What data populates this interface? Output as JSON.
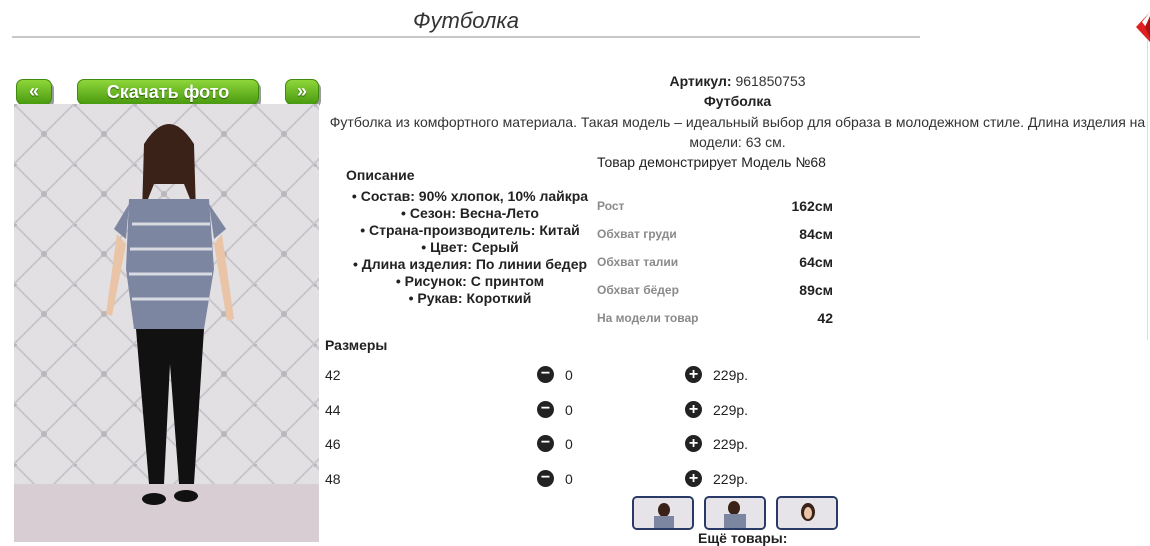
{
  "header": {
    "title": "Футболка"
  },
  "gallery": {
    "prev_label": "«",
    "download_label": "Скачать фото",
    "next_label": "»"
  },
  "product": {
    "article_label": "Артикул:",
    "article_value": "961850753",
    "name": "Футболка",
    "description": "Футболка из комфортного материала. Такая модель – идеальный выбор для образа в молодежном стиле. Длина изделия на модели: 63 см.",
    "model_note": "Товар демонстрирует Модель №68"
  },
  "description_section": {
    "title": "Описание",
    "items": [
      "Состав: 90% хлопок, 10% лайкра",
      "Сезон: Весна-Лето",
      "Страна-производитель: Китай",
      "Цвет: Серый",
      "Длина изделия: По линии бедер",
      "Рисунок: С принтом",
      "Рукав: Короткий"
    ]
  },
  "model_params": [
    {
      "label": "Рост",
      "value": "162см"
    },
    {
      "label": "Обхват груди",
      "value": "84см"
    },
    {
      "label": "Обхват талии",
      "value": "64см"
    },
    {
      "label": "Обхват бёдер",
      "value": "89см"
    },
    {
      "label": "На модели товар",
      "value": "42"
    }
  ],
  "sizes": {
    "title": "Размеры",
    "rows": [
      {
        "size": "42",
        "qty": "0",
        "price": "229р."
      },
      {
        "size": "44",
        "qty": "0",
        "price": "229р."
      },
      {
        "size": "46",
        "qty": "0",
        "price": "229р."
      },
      {
        "size": "48",
        "qty": "0",
        "price": "229р."
      }
    ]
  },
  "more_label": "Ещё товары:",
  "colors": {
    "button_green": "#5fb01f",
    "close_red": "#e02020",
    "thumb_border": "#2a3a66"
  }
}
